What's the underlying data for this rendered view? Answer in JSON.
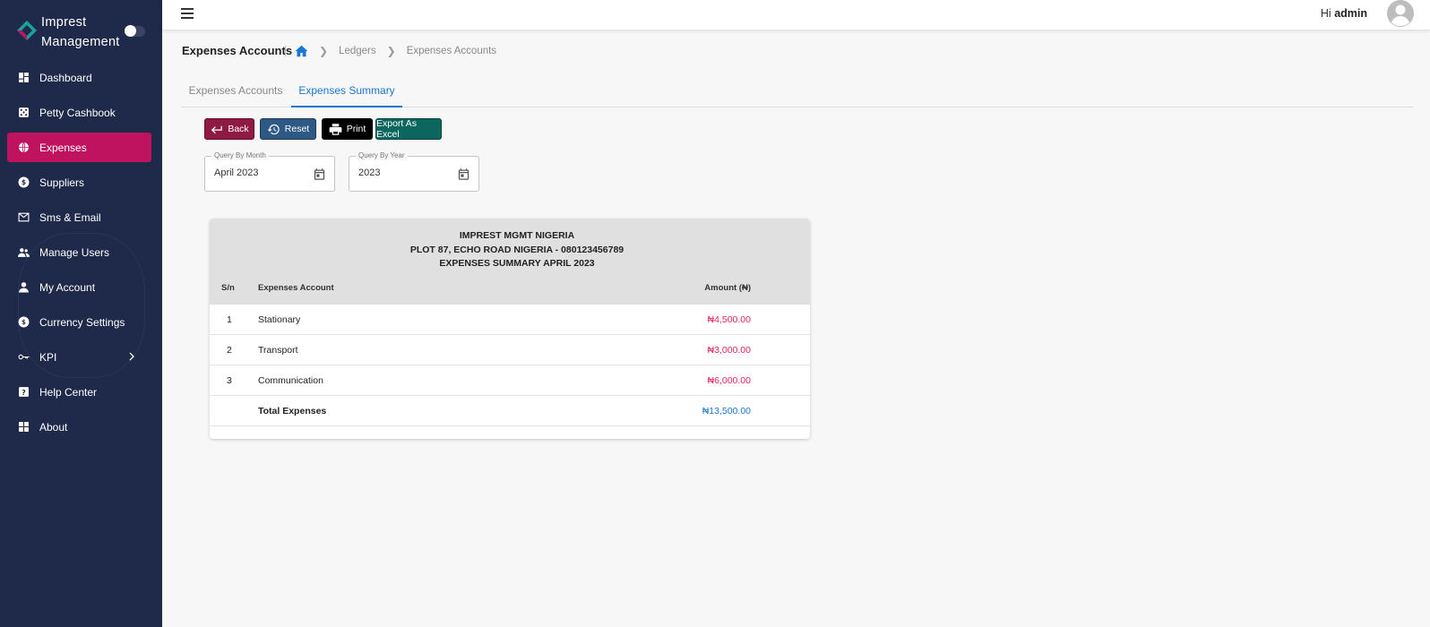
{
  "brand": {
    "line1": "Imprest",
    "line2": "Management"
  },
  "sidebar": {
    "items": [
      {
        "label": "Dashboard",
        "icon": "dashboard-icon"
      },
      {
        "label": "Petty Cashbook",
        "icon": "dice-icon"
      },
      {
        "label": "Expenses",
        "icon": "globe-icon",
        "active": true
      },
      {
        "label": "Suppliers",
        "icon": "dollar-coin-icon"
      },
      {
        "label": "Sms & Email",
        "icon": "mail-icon"
      },
      {
        "label": "Manage Users",
        "icon": "users-icon"
      },
      {
        "label": "My Account",
        "icon": "person-icon"
      },
      {
        "label": "Currency Settings",
        "icon": "currency-icon"
      },
      {
        "label": "KPI",
        "icon": "key-icon",
        "has_submenu": true
      },
      {
        "label": "Help Center",
        "icon": "help-icon"
      },
      {
        "label": "About",
        "icon": "grid-icon"
      }
    ],
    "colors": {
      "background": "#1f2a4a",
      "active": "#c0135f"
    }
  },
  "header": {
    "greeting": "Hi",
    "user": "admin"
  },
  "page": {
    "title": "Expenses Accounts",
    "breadcrumb": [
      "Ledgers",
      "Expenses Accounts"
    ]
  },
  "tabs": [
    {
      "label": "Expenses Accounts",
      "active": false
    },
    {
      "label": "Expenses Summary",
      "active": true
    }
  ],
  "toolbar": {
    "back": "Back",
    "reset": "Reset",
    "print": "Print",
    "export": "Export As Excel",
    "colors": {
      "back": "#8e1a43",
      "reset": "#2e5984",
      "print": "#000000",
      "export": "#0b6660"
    }
  },
  "filters": {
    "month": {
      "label": "Query By Month",
      "value": "April 2023"
    },
    "year": {
      "label": "Query By Year",
      "value": "2023"
    }
  },
  "report": {
    "company": "IMPREST MGMT NIGERIA",
    "address": "PLOT 87, ECHO ROAD NIGERIA - 080123456789",
    "title": "EXPENSES SUMMARY APRIL 2023",
    "columns": {
      "sn": "S/n",
      "account": "Expenses Account",
      "amount": "Amount (₦)"
    },
    "rows": [
      {
        "sn": "1",
        "account": "Stationary",
        "amount": "₦4,500.00"
      },
      {
        "sn": "2",
        "account": "Transport",
        "amount": "₦3,000.00"
      },
      {
        "sn": "3",
        "account": "Communication",
        "amount": "₦6,000.00"
      }
    ],
    "total": {
      "label": "Total Expenses",
      "amount": "₦13,500.00"
    }
  }
}
